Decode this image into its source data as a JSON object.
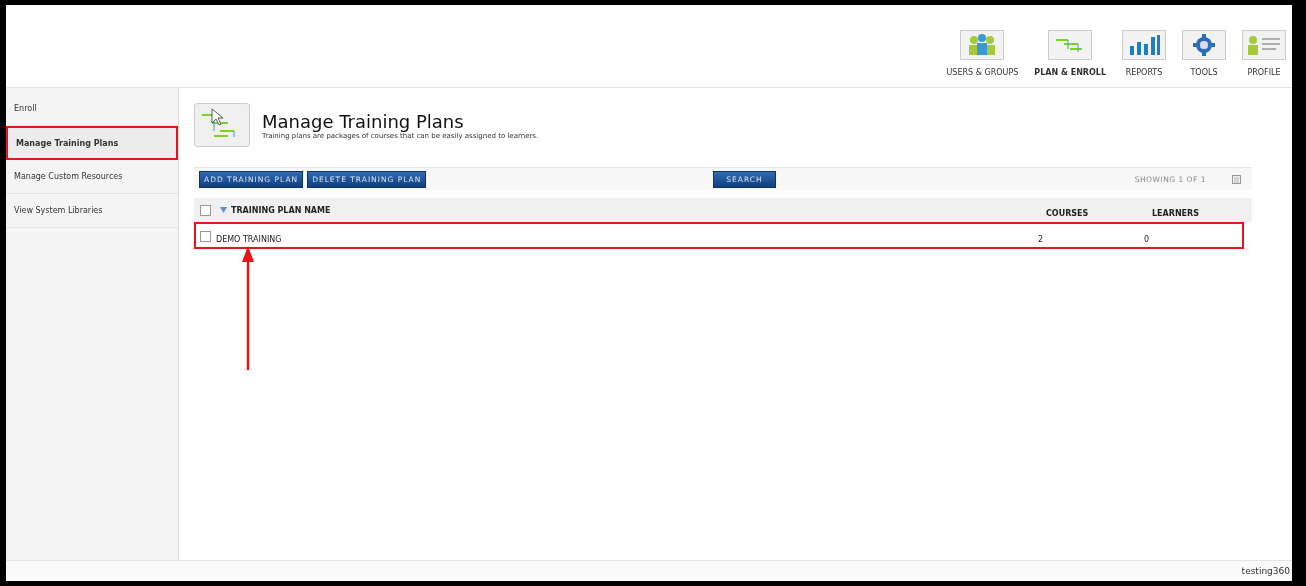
{
  "nav": [
    {
      "label": "USERS & GROUPS",
      "selected": false
    },
    {
      "label": "PLAN & ENROLL",
      "selected": true
    },
    {
      "label": "REPORTS",
      "selected": false
    },
    {
      "label": "TOOLS",
      "selected": false
    },
    {
      "label": "PROFILE",
      "selected": false
    }
  ],
  "sidebar": {
    "items": [
      {
        "label": "Enroll",
        "selected": false,
        "highlighted": false
      },
      {
        "label": "Manage Training Plans",
        "selected": true,
        "highlighted": true
      },
      {
        "label": "Manage Custom Resources",
        "selected": false,
        "highlighted": false
      },
      {
        "label": "View System Libraries",
        "selected": false,
        "highlighted": false
      }
    ]
  },
  "page": {
    "title": "Manage Training Plans",
    "subtitle": "Training plans are packages of courses that can be easily assigned to learners."
  },
  "toolbar": {
    "buttons": [
      "ADD TRAINING PLAN",
      "DELETE TRAINING PLAN"
    ],
    "search_button": "SEARCH",
    "showing": "SHOWING 1 OF 1"
  },
  "table": {
    "select_all_checked": false,
    "columns": [
      "TRAINING PLAN NAME",
      "COURSES",
      "LEARNERS"
    ],
    "rows": [
      {
        "checked": false,
        "highlighted": true,
        "cells": [
          "DEMO TRAINING",
          "2",
          "0"
        ]
      }
    ]
  },
  "status_bar": {
    "user": "testing360"
  }
}
